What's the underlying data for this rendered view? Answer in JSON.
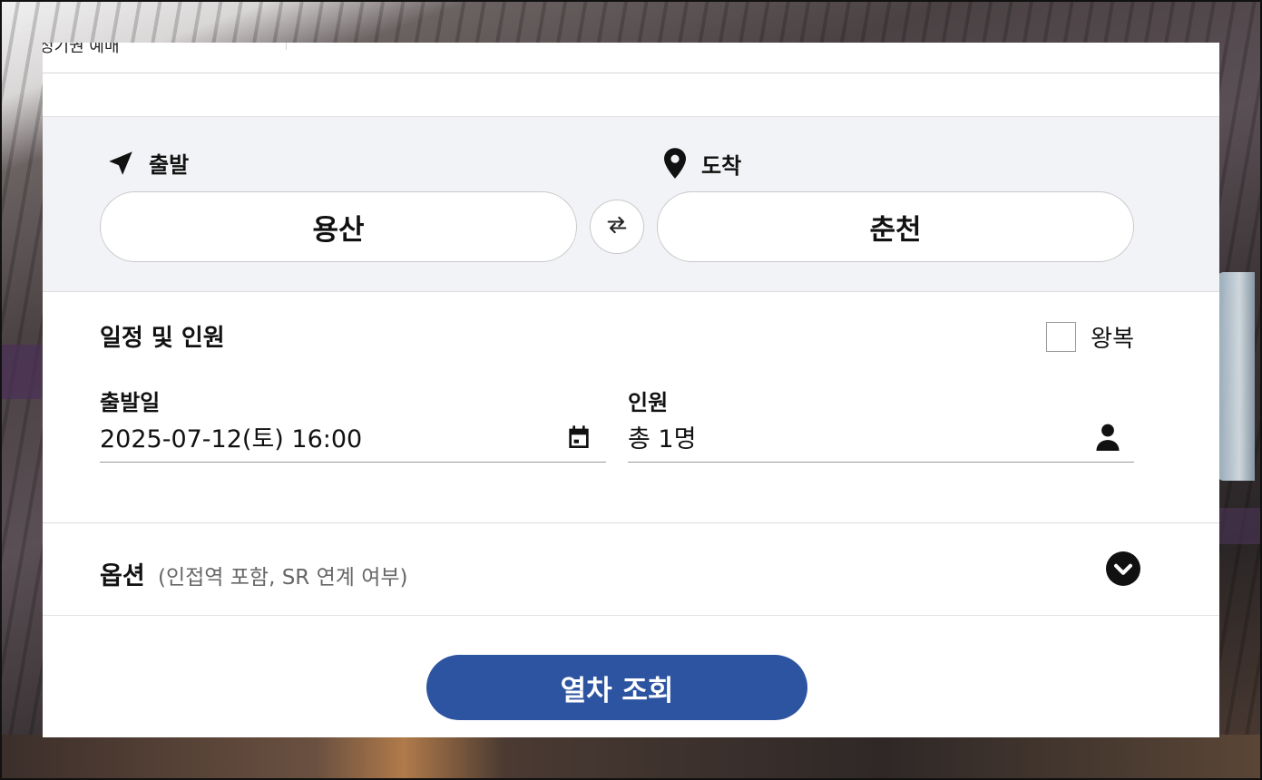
{
  "top_tab": {
    "text": "정기권 예매"
  },
  "route": {
    "departure_label": "출발",
    "arrival_label": "도착",
    "departure_station": "용산",
    "arrival_station": "춘천",
    "icons": {
      "departure": "navigation-arrow-icon",
      "arrival": "map-pin-icon",
      "swap": "swap-arrows-icon"
    }
  },
  "schedule": {
    "title": "일정 및 인원",
    "roundtrip_label": "왕복",
    "roundtrip_checked": false,
    "date_label": "출발일",
    "date_value": "2025-07-12(토) 16:00",
    "passenger_label": "인원",
    "passenger_value": "총 1명",
    "icons": {
      "date": "calendar-icon",
      "passenger": "person-icon"
    }
  },
  "options": {
    "title": "옵션",
    "subtitle": "(인접역 포함, SR 연계 여부)",
    "icon": "chevron-down-circle-icon"
  },
  "search_button": {
    "label": "열차 조회"
  },
  "colors": {
    "primary": "#2d54a0",
    "route_bg": "#f2f3f6",
    "text": "#111111",
    "muted": "#666666"
  }
}
